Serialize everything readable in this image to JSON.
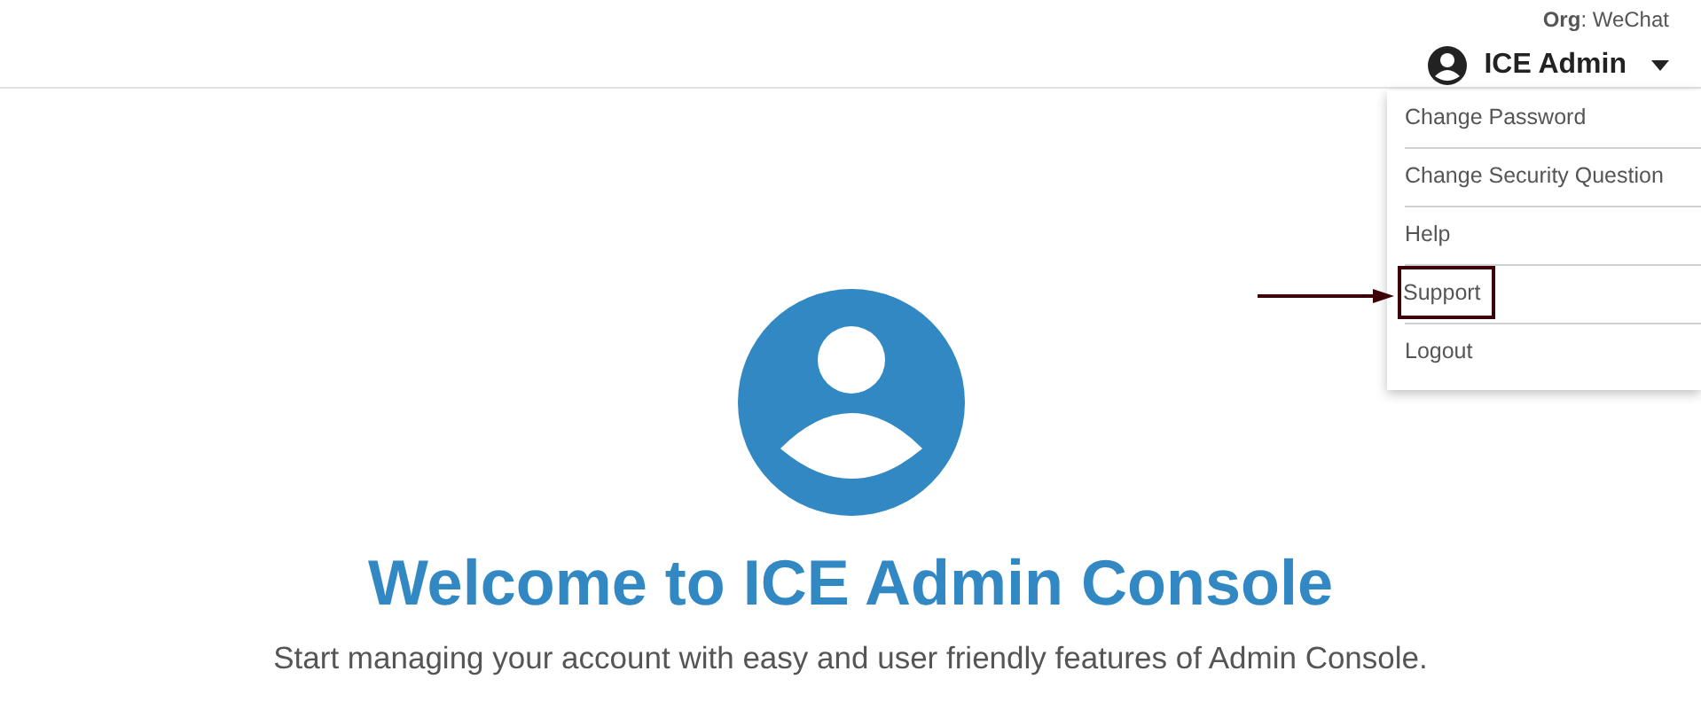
{
  "header": {
    "org": "**Org**: WeChat",
    "user_name": "ICE Admin",
    "menu_expanded": true
  },
  "user_menu": [
    {
      "label": "Change Password",
      "highlighted": false
    },
    {
      "label": "Change Security Question",
      "highlighted": false
    },
    {
      "label": "Help",
      "highlighted": false
    },
    {
      "label": "Support",
      "highlighted": true
    },
    {
      "label": "Logout",
      "highlighted": false
    }
  ],
  "welcome": {
    "title": "Welcome to ICE Admin Console",
    "subtitle": "Start managing your account with easy and user friendly features of Admin Console."
  }
}
